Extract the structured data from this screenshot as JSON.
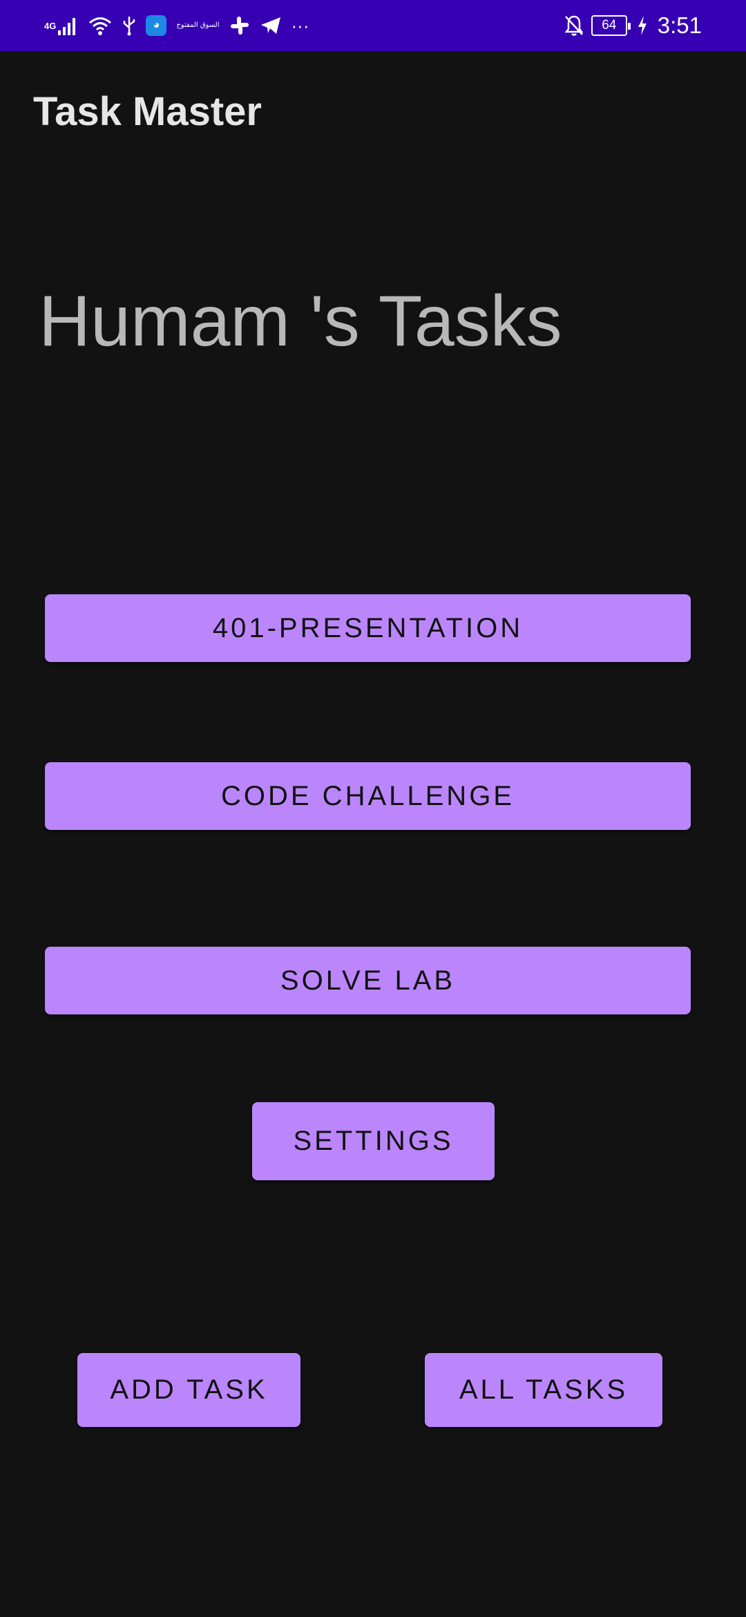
{
  "status_bar": {
    "network": "4G",
    "app_icon_text": "السوق المفتوح",
    "battery": "64",
    "time": "3:51",
    "more": "···",
    "icons": [
      "signal-icon",
      "wifi-icon",
      "usb-icon",
      "chat-app-icon",
      "opensooq-app-icon",
      "slack-icon",
      "telegram-icon",
      "more-icon",
      "notifications-off-icon",
      "battery-icon",
      "charging-icon"
    ]
  },
  "app_bar": {
    "title": "Task Master"
  },
  "main": {
    "heading": "Humam 's Tasks",
    "tasks": [
      {
        "label": "401-PRESENTATION"
      },
      {
        "label": "CODE CHALLENGE"
      },
      {
        "label": "SOLVE LAB"
      }
    ],
    "settings_label": "SETTINGS",
    "add_task_label": "ADD TASK",
    "all_tasks_label": "ALL TASKS"
  },
  "colors": {
    "status_bar": "#3700b3",
    "background": "#121212",
    "button": "#bb86fc",
    "button_text": "#111111",
    "heading_text": "#b8b8b8"
  }
}
